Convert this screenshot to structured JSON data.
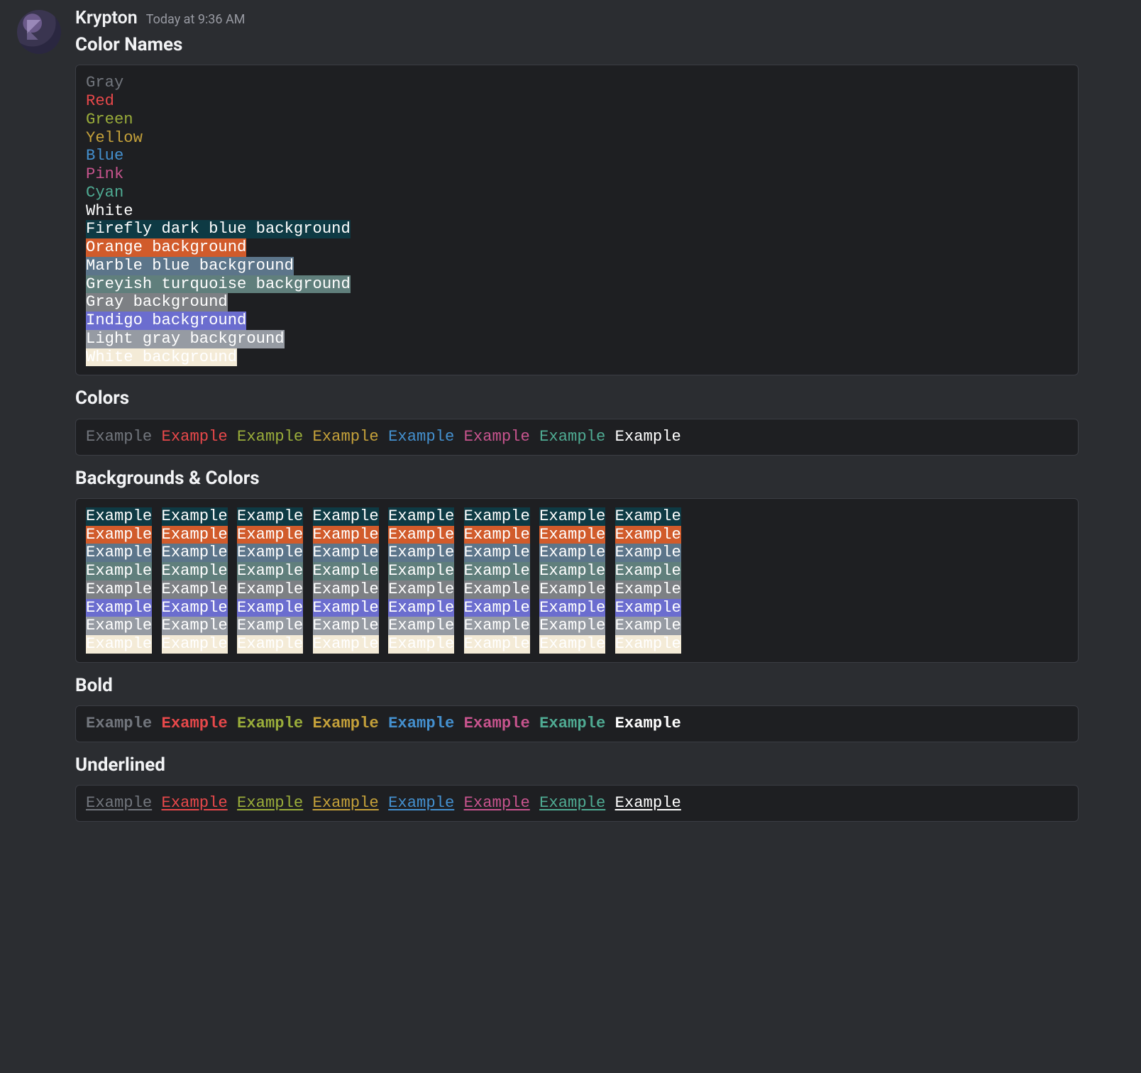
{
  "message": {
    "username": "Krypton",
    "timestamp": "Today at 9:36 AM"
  },
  "sections": {
    "colorNames": {
      "title": "Color Names"
    },
    "colors": {
      "title": "Colors"
    },
    "bgColors": {
      "title": "Backgrounds & Colors"
    },
    "bold": {
      "title": "Bold"
    },
    "underlined": {
      "title": "Underlined"
    }
  },
  "example_word": "Example",
  "fg_colors": [
    "gray",
    "red",
    "green",
    "yellow",
    "blue",
    "pink",
    "cyan",
    "white"
  ],
  "bg_colors": [
    "firefly",
    "orange",
    "marble",
    "turquoise",
    "gray",
    "indigo",
    "lightgray",
    "white"
  ],
  "color_name_lines": [
    {
      "text": "Gray",
      "fg": "gray"
    },
    {
      "text": "Red",
      "fg": "red"
    },
    {
      "text": "Green",
      "fg": "green"
    },
    {
      "text": "Yellow",
      "fg": "yellow"
    },
    {
      "text": "Blue",
      "fg": "blue"
    },
    {
      "text": "Pink",
      "fg": "pink"
    },
    {
      "text": "Cyan",
      "fg": "cyan"
    },
    {
      "text": "White",
      "fg": "white"
    },
    {
      "text": "Firefly dark blue background",
      "bg": "firefly"
    },
    {
      "text": "Orange background",
      "bg": "orange"
    },
    {
      "text": "Marble blue background",
      "bg": "marble"
    },
    {
      "text": "Greyish turquoise background",
      "bg": "turquoise"
    },
    {
      "text": "Gray background",
      "bg": "gray"
    },
    {
      "text": "Indigo background",
      "bg": "indigo"
    },
    {
      "text": "Light gray background",
      "bg": "lightgray"
    },
    {
      "text": "White background",
      "bg": "white"
    }
  ],
  "palette": {
    "fg": {
      "gray": "#72767d",
      "red": "#e7484a",
      "green": "#9aad3a",
      "yellow": "#c5a13a",
      "blue": "#4490cf",
      "pink": "#c8548e",
      "cyan": "#4fab93",
      "white": "#ffffff"
    },
    "bg": {
      "firefly": "#0e3a44",
      "orange": "#d15b2b",
      "marble": "#5c758a",
      "turquoise": "#607f7c",
      "gray": "#7d8084",
      "indigo": "#6b6dcf",
      "lightgray": "#969ba3",
      "white": "#f4ebd7"
    }
  }
}
